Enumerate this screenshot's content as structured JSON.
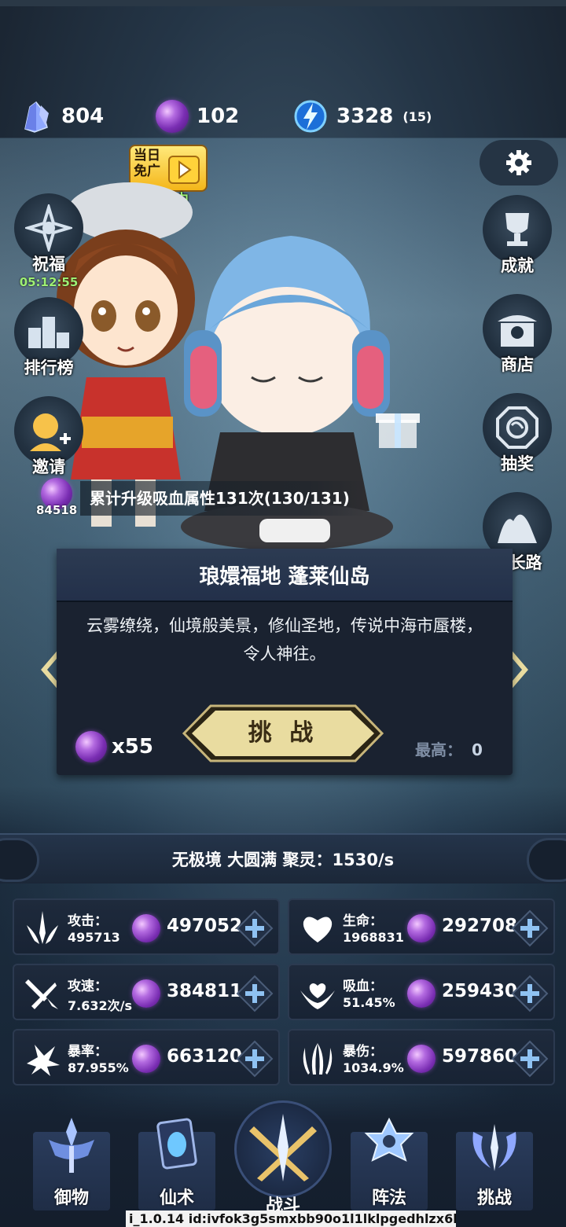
{
  "currencies": {
    "crystal": {
      "value": "804",
      "icon": "crystal-icon"
    },
    "orb": {
      "value": "102",
      "icon": "purple-orb-icon"
    },
    "energy": {
      "value": "3328",
      "sub": "(15)",
      "icon": "blue-energy-icon"
    }
  },
  "ad_badge": {
    "label": "当日免广",
    "status": "生效中"
  },
  "left_buttons": {
    "bless": {
      "label": "祝福",
      "timer": "05:12:55"
    },
    "rank": {
      "label": "排行榜"
    },
    "invite": {
      "label": "邀请"
    }
  },
  "right_buttons": {
    "achievement": {
      "label": "成就"
    },
    "shop": {
      "label": "商店"
    },
    "lottery": {
      "label": "抽奖"
    },
    "growth": {
      "label": "成长路"
    }
  },
  "notice": {
    "orb_count": "84518",
    "message": "累计升级吸血属性131次(130/131)"
  },
  "stage": {
    "title": "琅嬛福地 蓬莱仙岛",
    "description": "云雾缭绕，仙境般美景，修仙圣地，传说中海市蜃楼，令人神往。",
    "cost": "x55",
    "challenge_label": "挑 战",
    "best_label": "最高：",
    "best_value": "0"
  },
  "realm": {
    "text": "无极境 大圆满 聚灵：1530/s"
  },
  "stats": [
    {
      "name": "攻击：",
      "current": "495713",
      "cost": "497052",
      "icon": "attack-icon"
    },
    {
      "name": "生命：",
      "current": "1968831",
      "cost": "292708",
      "icon": "heart-icon"
    },
    {
      "name": "攻速：",
      "current": "7.632次/s",
      "cost": "384811",
      "icon": "attack-speed-icon"
    },
    {
      "name": "吸血：",
      "current": "51.45%",
      "cost": "259430",
      "icon": "lifesteal-icon"
    },
    {
      "name": "暴率：",
      "current": "87.955%",
      "cost": "663120",
      "icon": "crit-rate-icon"
    },
    {
      "name": "暴伤：",
      "current": "1034.9%",
      "cost": "597860",
      "icon": "crit-damage-icon"
    }
  ],
  "nav": [
    {
      "label": "御物",
      "icon": "equipment-icon"
    },
    {
      "label": "仙术",
      "icon": "spell-card-icon"
    },
    {
      "label": "战斗",
      "icon": "battle-icon"
    },
    {
      "label": "阵法",
      "icon": "formation-icon"
    },
    {
      "label": "挑战",
      "icon": "challenge-icon"
    }
  ],
  "version": "i_1.0.14 id:ivfok3g5smxbb90o1l1lklpgedhlzx6l",
  "colors": {
    "accent_gold": "#e9dca0",
    "orb_purple": "#8a3cc4",
    "timer_green": "#9ef074"
  }
}
